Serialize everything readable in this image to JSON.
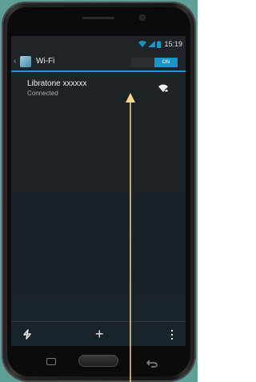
{
  "status_bar": {
    "time": "15:19",
    "icons": [
      "wifi-icon",
      "signal-icon",
      "battery-icon"
    ]
  },
  "action_bar": {
    "back_glyph": "‹",
    "title": "Wi-Fi",
    "toggle_label": "ON",
    "accent_color": "#1a95c9"
  },
  "networks": [
    {
      "name": "Libratone xxxxxx",
      "status": "Connected",
      "icon": "wifi-lock-icon"
    }
  ],
  "bottom_bar": {
    "add_glyph": "+",
    "icons": [
      "wifi-direct-icon",
      "add-icon",
      "overflow-menu-icon"
    ]
  },
  "annotation": {
    "color": "#f4d58d",
    "points_to": "network-row"
  },
  "colors": {
    "background": "#5e9f98",
    "screen": "#1c2226"
  }
}
